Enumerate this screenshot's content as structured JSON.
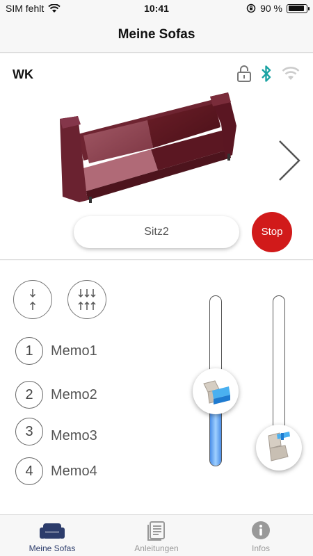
{
  "status_bar": {
    "carrier": "SIM fehlt",
    "time": "10:41",
    "battery_text": "90 %",
    "battery_level": 0.9
  },
  "nav": {
    "title": "Meine Sofas"
  },
  "sofa": {
    "name": "WK",
    "seat_label": "Sitz2",
    "stop_label": "Stop",
    "icons": [
      "lock-icon",
      "bluetooth-icon",
      "wifi-icon",
      "chevron-right-icon"
    ],
    "colors": {
      "bluetooth": "#1aa3a3",
      "stop": "#d11a1a",
      "sofa": "#7a2a36"
    }
  },
  "controls": {
    "icons": [
      "single-arrows-icon",
      "multi-arrows-icon"
    ],
    "memos": [
      {
        "number": "1",
        "label": "Memo1"
      },
      {
        "number": "2",
        "label": "Memo2"
      },
      {
        "number": "3",
        "label": "Memo3"
      },
      {
        "number": "4",
        "label": "Memo4"
      }
    ],
    "slider_back_level": 0.44,
    "slider_feet_level": 0.0
  },
  "tabs": [
    {
      "label": "Meine Sofas",
      "icon": "sofa-icon",
      "active": true
    },
    {
      "label": "Anleitungen",
      "icon": "manual-icon",
      "active": false
    },
    {
      "label": "Infos",
      "icon": "info-icon",
      "active": false
    }
  ]
}
